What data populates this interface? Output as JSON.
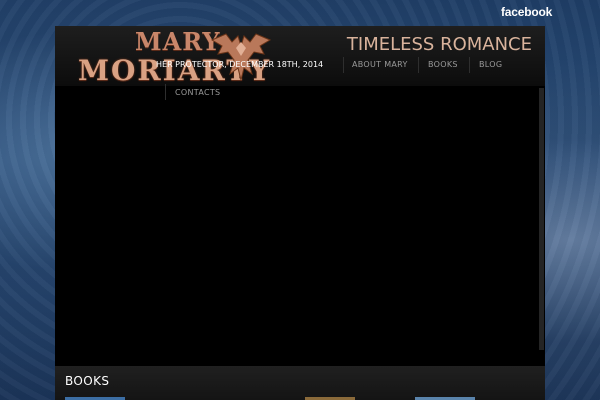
{
  "facebook": {
    "label": "facebook"
  },
  "logo": {
    "line1": "MARY",
    "line2": "MORIARTY"
  },
  "tagline": "TIMELESS ROMANCE",
  "nav": {
    "post_crumb": "HER PROTECTOR, DECEMBER 18TH, 2014",
    "items": [
      {
        "label": "ABOUT MARY"
      },
      {
        "label": "BOOKS"
      },
      {
        "label": "BLOG"
      },
      {
        "label": "CONTACTS"
      }
    ]
  },
  "books_section": {
    "title": "BOOKS"
  },
  "colors": {
    "accent": "#d9a183",
    "tagline": "#d9b39c",
    "page_bg": "#000000"
  }
}
